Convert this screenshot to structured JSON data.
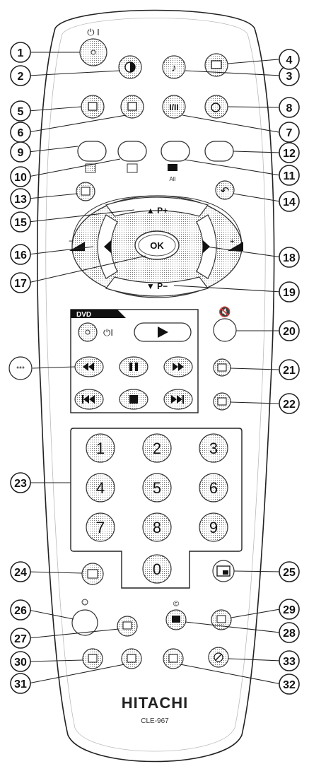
{
  "brand": "HITACHI",
  "model": "CLE-967",
  "dvd_label": "DVD",
  "ok_label": "OK",
  "prog_up_label": "▲ P+",
  "prog_down_label": "▼ P−",
  "dvd_power_label": "⏻I",
  "power_label": "⏻ I",
  "dual_label": "I/II",
  "all_label": "All",
  "asterisk_label": "***",
  "numbers": [
    "1",
    "2",
    "3",
    "4",
    "5",
    "6",
    "7",
    "8",
    "9",
    "0"
  ],
  "callouts": [
    "1",
    "2",
    "3",
    "4",
    "5",
    "6",
    "7",
    "8",
    "9",
    "10",
    "11",
    "12",
    "13",
    "14",
    "15",
    "16",
    "17",
    "18",
    "19",
    "20",
    "21",
    "22",
    "23",
    "24",
    "25",
    "26",
    "27",
    "28",
    "29",
    "30",
    "31",
    "32",
    "33"
  ]
}
